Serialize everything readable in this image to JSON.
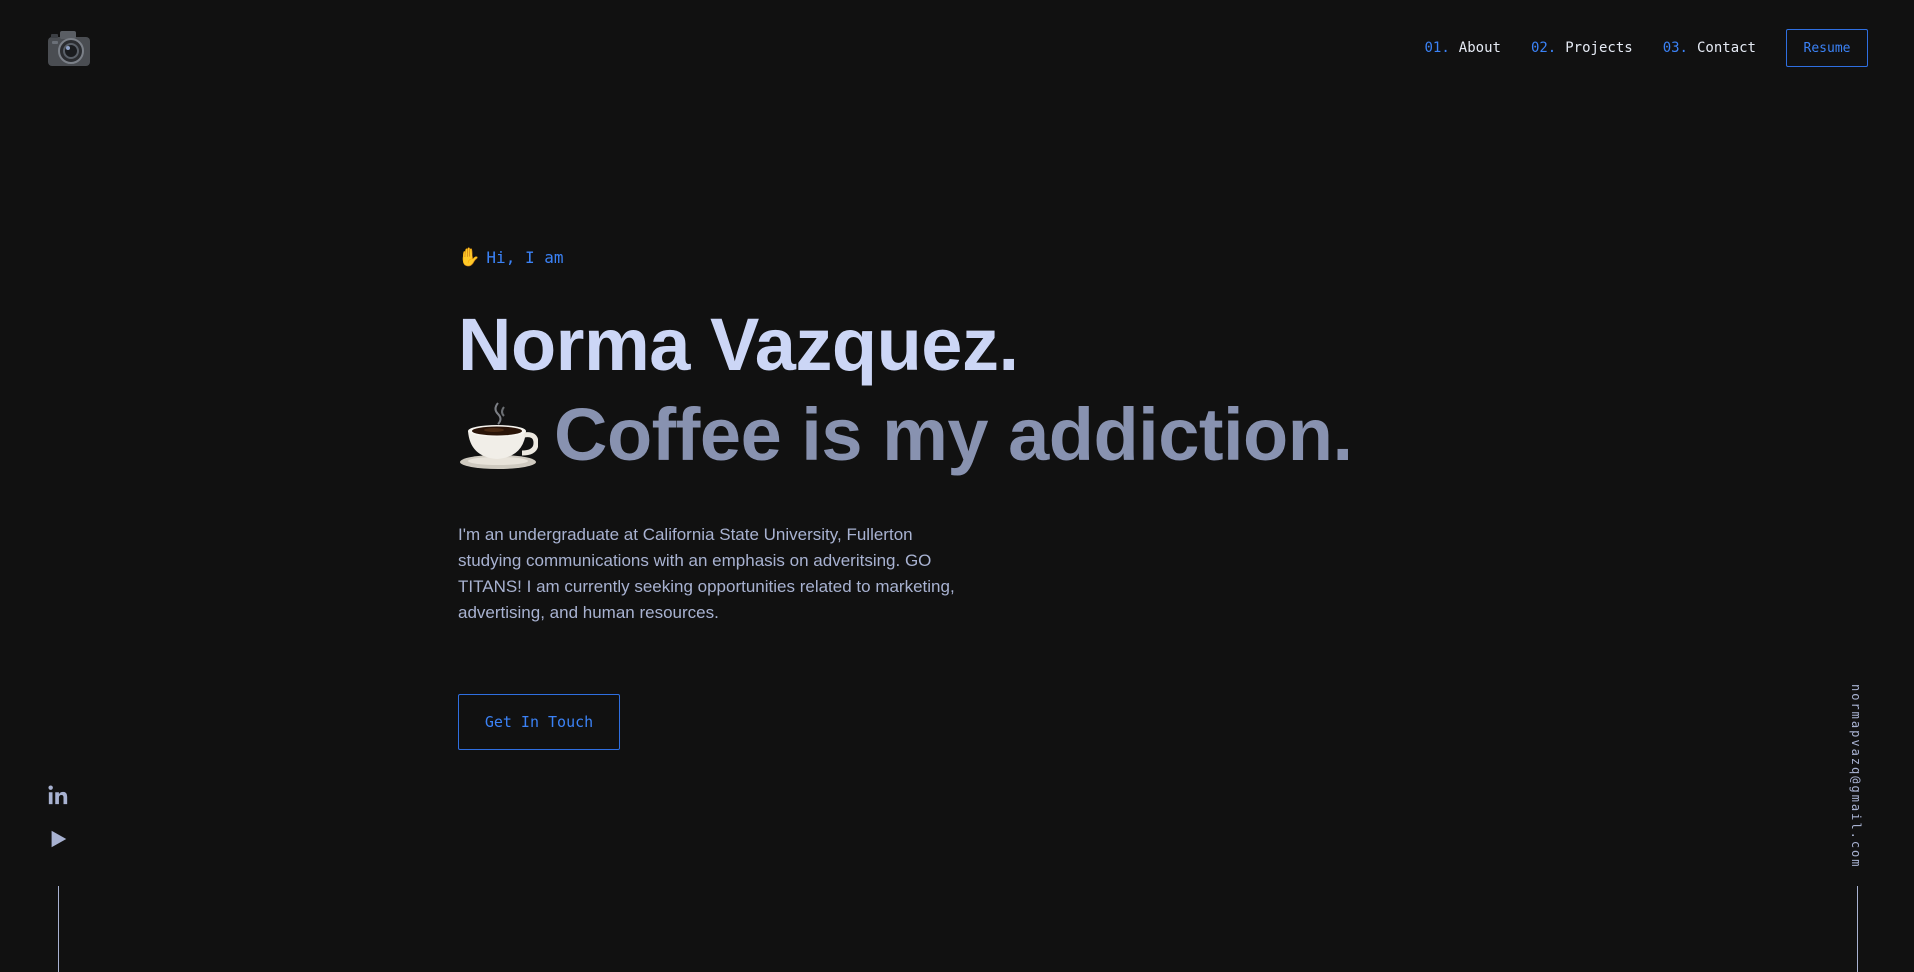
{
  "header": {
    "logo_icon": "camera-icon",
    "nav": [
      {
        "num": "01.",
        "label": "About"
      },
      {
        "num": "02.",
        "label": "Projects"
      },
      {
        "num": "03.",
        "label": "Contact"
      }
    ],
    "resume_label": "Resume"
  },
  "hero": {
    "wave_icon": "waving-hand-icon",
    "greeting": "Hi, I am",
    "name": "Norma Vazquez.",
    "cup_icon": "coffee-cup-icon",
    "tagline": "Coffee is my addiction.",
    "bio": "I'm an undergraduate at California State University, Fullerton studying communications with an emphasis on adveritsing. GO TITANS! I am currently seeking opportunities related to marketing, advertising, and human resources.",
    "cta_label": "Get In Touch"
  },
  "social": {
    "icons": [
      "linkedin-icon",
      "play-icon"
    ]
  },
  "email": "normapvazq@gmail.com",
  "colors": {
    "background": "#111111",
    "accent": "#3b82f6",
    "heading": "#ccd6f6",
    "subheading": "#8892b0",
    "body": "#a8b2d1"
  }
}
